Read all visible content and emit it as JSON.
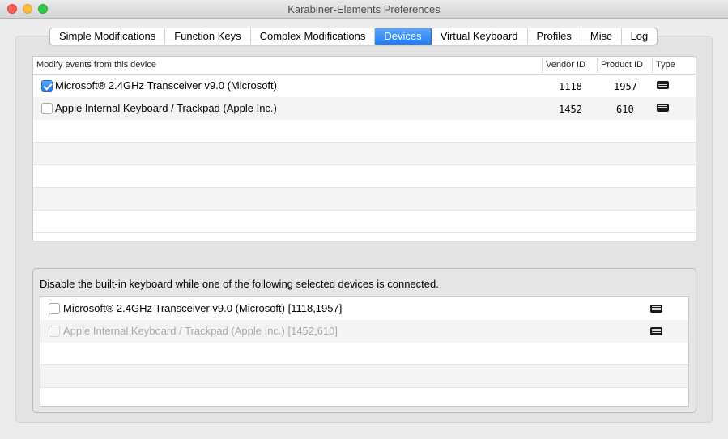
{
  "window": {
    "title": "Karabiner-Elements Preferences"
  },
  "tabs": [
    {
      "label": "Simple Modifications",
      "active": false
    },
    {
      "label": "Function Keys",
      "active": false
    },
    {
      "label": "Complex Modifications",
      "active": false
    },
    {
      "label": "Devices",
      "active": true
    },
    {
      "label": "Virtual Keyboard",
      "active": false
    },
    {
      "label": "Profiles",
      "active": false
    },
    {
      "label": "Misc",
      "active": false
    },
    {
      "label": "Log",
      "active": false
    }
  ],
  "devices_table": {
    "columns": {
      "name": "Modify events from this device",
      "vendor": "Vendor ID",
      "product": "Product ID",
      "type": "Type"
    },
    "rows": [
      {
        "name": "Microsoft® 2.4GHz Transceiver v9.0 (Microsoft)",
        "vendor_id": "1118",
        "product_id": "1957",
        "checked": true,
        "type_icon": "keyboard-icon"
      },
      {
        "name": "Apple Internal Keyboard / Trackpad (Apple Inc.)",
        "vendor_id": "1452",
        "product_id": "610",
        "checked": false,
        "type_icon": "keyboard-icon"
      }
    ]
  },
  "disable_builtin": {
    "label": "Disable the built-in keyboard while one of the following selected devices is connected.",
    "rows": [
      {
        "name": "Microsoft® 2.4GHz Transceiver v9.0 (Microsoft) [1118,1957]",
        "checked": false,
        "disabled": false,
        "type_icon": "keyboard-icon"
      },
      {
        "name": "Apple Internal Keyboard / Trackpad (Apple Inc.) [1452,610]",
        "checked": false,
        "disabled": true,
        "type_icon": "keyboard-icon"
      }
    ]
  }
}
